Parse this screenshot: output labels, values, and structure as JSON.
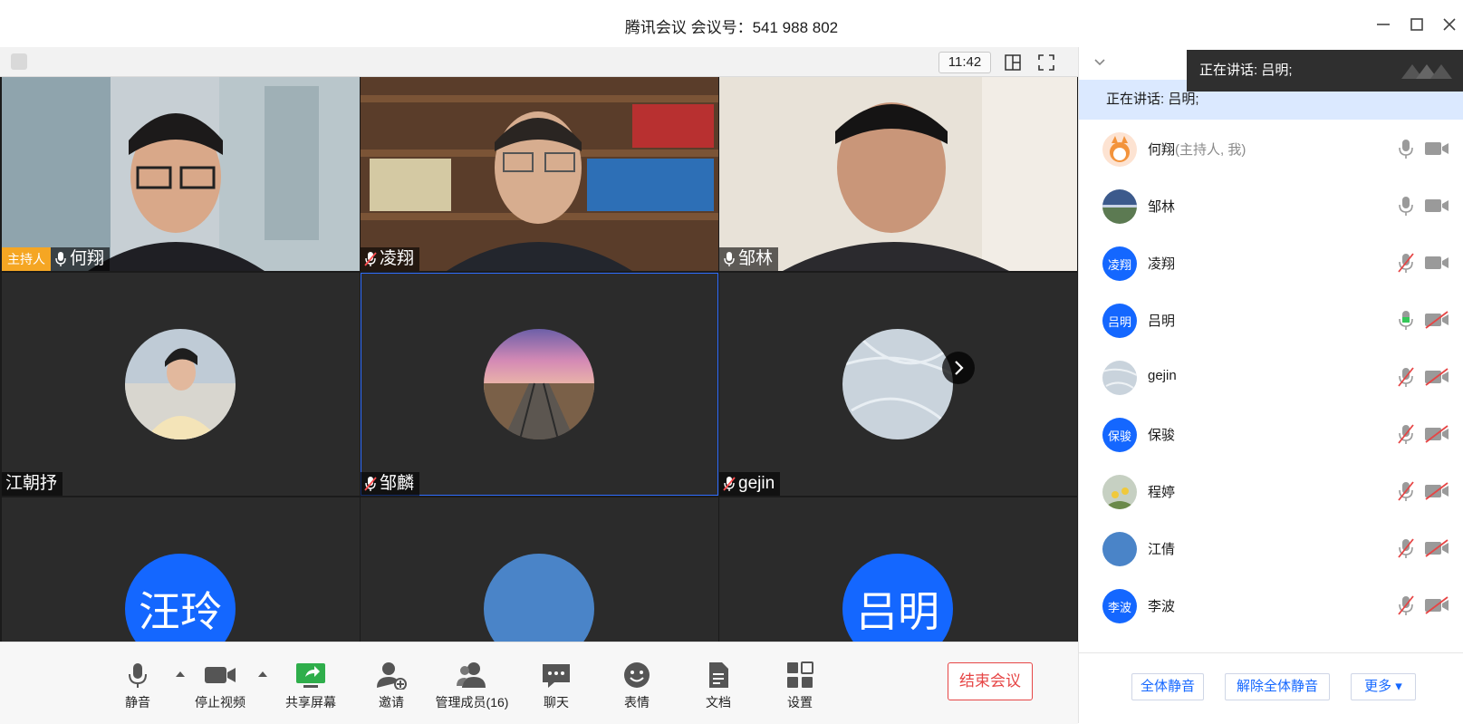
{
  "window": {
    "title": "腾讯会议 会议号：541 988 802"
  },
  "stage": {
    "time": "11:42",
    "tiles": [
      {
        "name": "何翔",
        "host_badge": "主持人",
        "mic": "on"
      },
      {
        "name": "凌翔",
        "mic": "muted"
      },
      {
        "name": "邹林",
        "mic": "on"
      },
      {
        "name": "江朝抒"
      },
      {
        "name": "邹麟",
        "mic": "muted",
        "active": true
      },
      {
        "name": "gejin",
        "mic": "muted"
      },
      {
        "name": "",
        "avatar_text": "汪玲"
      },
      {
        "name": ""
      },
      {
        "name": "",
        "avatar_text": "吕明"
      }
    ]
  },
  "toolbar": {
    "mute": "静音",
    "stop_video": "停止视频",
    "share_screen": "共享屏幕",
    "invite": "邀请",
    "manage_members": "管理成员(16)",
    "chat": "聊天",
    "emoji": "表情",
    "docs": "文档",
    "settings": "设置",
    "end_meeting": "结束会议"
  },
  "sidebar": {
    "toast": "正在讲话: 吕明;",
    "speaking": "正在讲话: 吕明;",
    "participants": [
      {
        "name": "何翔",
        "role": "(主持人, 我)",
        "mic": "on",
        "cam": "on"
      },
      {
        "name": "邹林",
        "mic": "on",
        "cam": "on"
      },
      {
        "name": "凌翔",
        "avatar_text": "凌翔",
        "mic": "muted",
        "cam": "on"
      },
      {
        "name": "吕明",
        "avatar_text": "吕明",
        "mic": "speaking",
        "cam": "off"
      },
      {
        "name": "gejin",
        "mic": "muted",
        "cam": "off"
      },
      {
        "name": "保骏",
        "avatar_text": "保骏",
        "mic": "muted",
        "cam": "off"
      },
      {
        "name": "程婷",
        "mic": "muted",
        "cam": "off"
      },
      {
        "name": "江倩",
        "mic": "muted",
        "cam": "off"
      },
      {
        "name": "李波",
        "avatar_text": "李波",
        "mic": "muted",
        "cam": "off"
      }
    ],
    "mute_all": "全体静音",
    "unmute_all": "解除全体静音",
    "more": "更多 ▾"
  },
  "colors": {
    "accent": "#1467ff",
    "danger": "#e64545",
    "host_badge": "#f5a623",
    "speaking_bg": "#dbe9ff",
    "mic_active": "#35c759"
  }
}
